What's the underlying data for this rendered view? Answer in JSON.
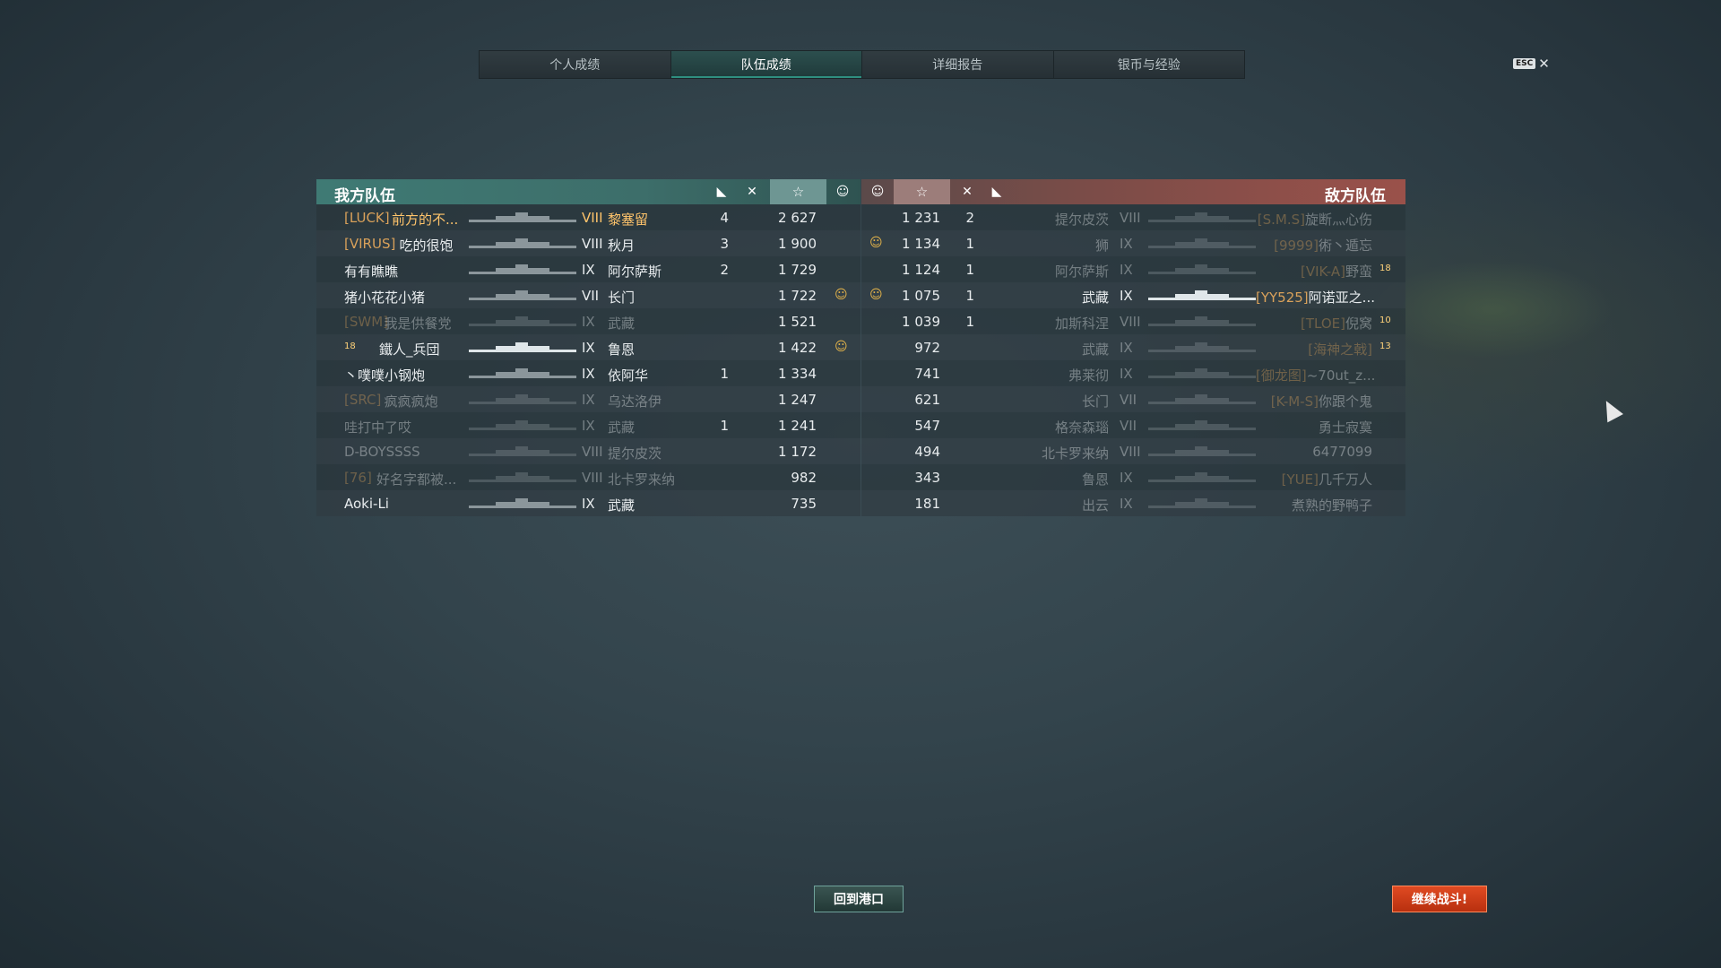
{
  "tabs": [
    "个人成绩",
    "队伍成绩",
    "详细报告",
    "银币与经验"
  ],
  "active_tab": 1,
  "esc_label": "ESC",
  "close_glyph": "✕",
  "ally": {
    "title": "我方队伍",
    "rows": [
      {
        "clan": "[LUCK]",
        "name": "前方的不...",
        "tier": "VIII",
        "ship": "黎塞留",
        "frags": "4",
        "planes": "",
        "xp": "2 627",
        "coin": false,
        "highlight": true,
        "dead": false,
        "rank": ""
      },
      {
        "clan": "[VIRUS]",
        "name": "吃的很饱",
        "tier": "VIII",
        "ship": "秋月",
        "frags": "3",
        "planes": "",
        "xp": "1 900",
        "coin": false,
        "highlight": false,
        "dead": false,
        "rank": ""
      },
      {
        "clan": "",
        "name": "有有瞧瞧",
        "tier": "IX",
        "ship": "阿尔萨斯",
        "frags": "2",
        "planes": "",
        "xp": "1 729",
        "coin": false,
        "highlight": false,
        "dead": false,
        "rank": ""
      },
      {
        "clan": "",
        "name": "猪小花花小猪",
        "tier": "VII",
        "ship": "长门",
        "frags": "",
        "planes": "",
        "xp": "1 722",
        "coin": true,
        "highlight": false,
        "dead": false,
        "rank": ""
      },
      {
        "clan": "[SWM]",
        "name": "我是供餐党",
        "tier": "IX",
        "ship": "武藏",
        "frags": "",
        "planes": "",
        "xp": "1 521",
        "coin": false,
        "highlight": false,
        "dead": true,
        "rank": ""
      },
      {
        "clan": "",
        "name": "鐵人_兵団",
        "tier": "IX",
        "ship": "鲁恩",
        "frags": "",
        "planes": "",
        "xp": "1 422",
        "coin": true,
        "highlight": false,
        "dead": false,
        "rank": "18"
      },
      {
        "clan": "",
        "name": "丶噗噗小钢炮",
        "tier": "IX",
        "ship": "依阿华",
        "frags": "1",
        "planes": "",
        "xp": "1 334",
        "coin": false,
        "highlight": false,
        "dead": false,
        "rank": ""
      },
      {
        "clan": "[SRC]",
        "name": "疯疯疯炮",
        "tier": "IX",
        "ship": "乌达洛伊",
        "frags": "",
        "planes": "",
        "xp": "1 247",
        "coin": false,
        "highlight": false,
        "dead": true,
        "rank": ""
      },
      {
        "clan": "",
        "name": "哇打中了哎",
        "tier": "IX",
        "ship": "武藏",
        "frags": "1",
        "planes": "",
        "xp": "1 241",
        "coin": false,
        "highlight": false,
        "dead": true,
        "rank": ""
      },
      {
        "clan": "",
        "name": "D-BOYSSSS",
        "tier": "VIII",
        "ship": "提尔皮茨",
        "frags": "",
        "planes": "",
        "xp": "1 172",
        "coin": false,
        "highlight": false,
        "dead": true,
        "rank": ""
      },
      {
        "clan": "[76]",
        "name": "好名字都被...",
        "tier": "VIII",
        "ship": "北卡罗来纳",
        "frags": "",
        "planes": "",
        "xp": "982",
        "coin": false,
        "highlight": false,
        "dead": true,
        "rank": ""
      },
      {
        "clan": "",
        "name": "Aoki-Li",
        "tier": "IX",
        "ship": "武藏",
        "frags": "",
        "planes": "",
        "xp": "735",
        "coin": false,
        "highlight": false,
        "dead": false,
        "rank": ""
      }
    ]
  },
  "enemy": {
    "title": "敌方队伍",
    "rows": [
      {
        "clan": "[S.M.S]",
        "name": "旋断灬心伤",
        "tier": "VIII",
        "ship": "提尔皮茨",
        "frags": "2",
        "xp": "1 231",
        "coin": false,
        "dead": true,
        "rank": ""
      },
      {
        "clan": "[9999]",
        "name": "術丶遁忘",
        "tier": "IX",
        "ship": "狮",
        "frags": "1",
        "xp": "1 134",
        "coin": true,
        "dead": true,
        "rank": ""
      },
      {
        "clan": "[VIK-A]",
        "name": "野蛮",
        "tier": "IX",
        "ship": "阿尔萨斯",
        "frags": "1",
        "xp": "1 124",
        "coin": false,
        "dead": true,
        "rank": "18"
      },
      {
        "clan": "[YY525]",
        "name": "阿诺亚之...",
        "tier": "IX",
        "ship": "武藏",
        "frags": "1",
        "xp": "1 075",
        "coin": true,
        "dead": false,
        "rank": ""
      },
      {
        "clan": "[TLOE]",
        "name": "倪窝",
        "tier": "VIII",
        "ship": "加斯科涅",
        "frags": "1",
        "xp": "1 039",
        "coin": false,
        "dead": true,
        "rank": "10"
      },
      {
        "clan": "[海神之戟]",
        "name": "",
        "tier": "IX",
        "ship": "武藏",
        "frags": "",
        "xp": "972",
        "coin": false,
        "dead": true,
        "rank": "13"
      },
      {
        "clan": "[御龙图]",
        "name": "~70ut_z...",
        "tier": "IX",
        "ship": "弗莱彻",
        "frags": "",
        "xp": "741",
        "coin": false,
        "dead": true,
        "rank": ""
      },
      {
        "clan": "[K-M-S]",
        "name": "你跟个鬼",
        "tier": "VII",
        "ship": "长门",
        "frags": "",
        "xp": "621",
        "coin": false,
        "dead": true,
        "rank": ""
      },
      {
        "clan": "",
        "name": "勇士寂寞",
        "tier": "VII",
        "ship": "格奈森瑙",
        "frags": "",
        "xp": "547",
        "coin": false,
        "dead": true,
        "rank": ""
      },
      {
        "clan": "",
        "name": "6477099",
        "tier": "VIII",
        "ship": "北卡罗来纳",
        "frags": "",
        "xp": "494",
        "coin": false,
        "dead": true,
        "rank": ""
      },
      {
        "clan": "[YUE]",
        "name": "几千万人",
        "tier": "IX",
        "ship": "鲁恩",
        "frags": "",
        "xp": "343",
        "coin": false,
        "dead": true,
        "rank": ""
      },
      {
        "clan": "",
        "name": "煮熟的野鸭子",
        "tier": "IX",
        "ship": "出云",
        "frags": "",
        "xp": "181",
        "coin": false,
        "dead": true,
        "rank": ""
      }
    ]
  },
  "buttons": {
    "return_port": "回到港口",
    "continue": "继续战斗!"
  }
}
